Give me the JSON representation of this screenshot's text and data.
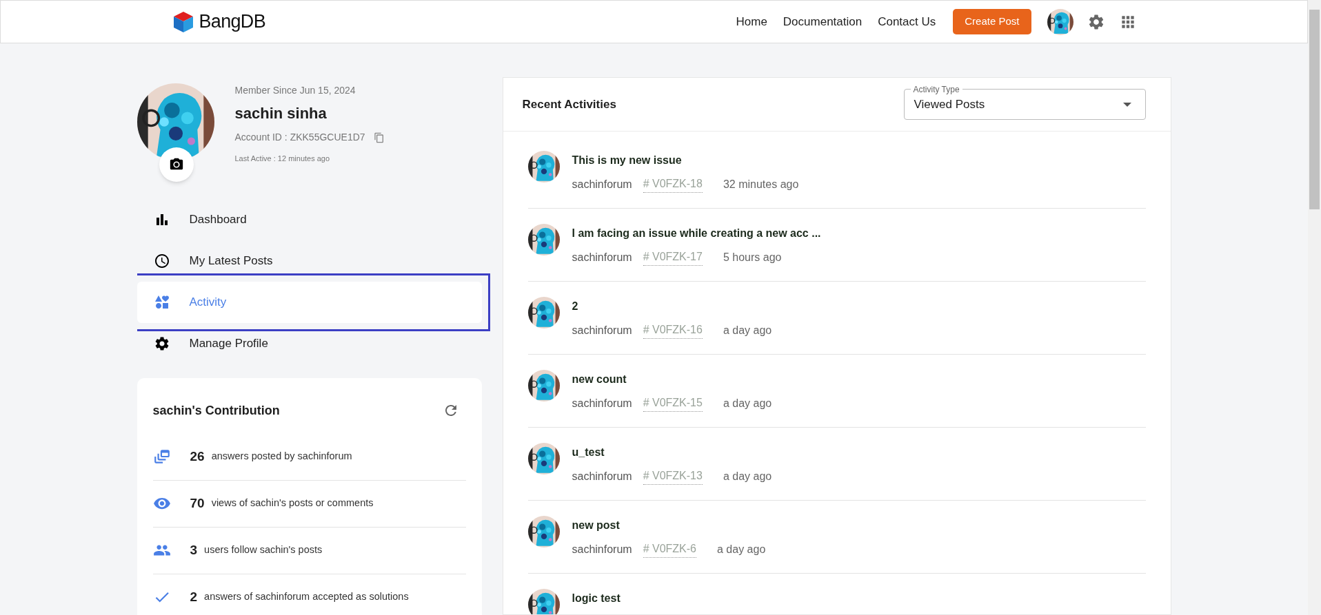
{
  "header": {
    "logo": "BangDB",
    "nav": [
      "Home",
      "Documentation",
      "Contact Us"
    ],
    "create_button": "Create Post"
  },
  "profile": {
    "member_since": "Member Since Jun 15, 2024",
    "name": "sachin sinha",
    "account_id": "Account ID : ZKK55GCUE1D7",
    "last_active": "Last Active : 12 minutes ago"
  },
  "menu": [
    {
      "kind": "dashboard",
      "label": "Dashboard",
      "selected": false,
      "highlighted": false
    },
    {
      "kind": "posts",
      "label": "My Latest Posts",
      "selected": false,
      "highlighted": false
    },
    {
      "kind": "activity",
      "label": "Activity",
      "selected": true,
      "highlighted": true
    },
    {
      "kind": "profile",
      "label": "Manage Profile",
      "selected": false,
      "highlighted": false
    }
  ],
  "contribution": {
    "title": "sachin's Contribution",
    "items": [
      {
        "kind": "answers",
        "count": "26",
        "text": "answers posted by sachinforum"
      },
      {
        "kind": "views",
        "count": "70",
        "text": "views of sachin's posts or comments"
      },
      {
        "kind": "followers",
        "count": "3",
        "text": "users follow sachin's posts"
      },
      {
        "kind": "accepted",
        "count": "2",
        "text": "answers of sachinforum accepted as solutions"
      }
    ]
  },
  "activities": {
    "title": "Recent Activities",
    "filter": {
      "label": "Activity Type",
      "value": "Viewed Posts"
    },
    "items": [
      {
        "title": "This is my new issue",
        "user": "sachinforum",
        "id": "# V0FZK-18",
        "time": "32 minutes ago"
      },
      {
        "title": "I am facing an issue while creating a new acc ...",
        "user": "sachinforum",
        "id": "# V0FZK-17",
        "time": "5 hours ago"
      },
      {
        "title": "2",
        "user": "sachinforum",
        "id": "# V0FZK-16",
        "time": "a day ago"
      },
      {
        "title": "new count",
        "user": "sachinforum",
        "id": "# V0FZK-15",
        "time": "a day ago"
      },
      {
        "title": "u_test",
        "user": "sachinforum",
        "id": "# V0FZK-13",
        "time": "a day ago"
      },
      {
        "title": "new post",
        "user": "sachinforum",
        "id": "# V0FZK-6",
        "time": "a day ago"
      },
      {
        "title": "logic test"
      }
    ]
  }
}
